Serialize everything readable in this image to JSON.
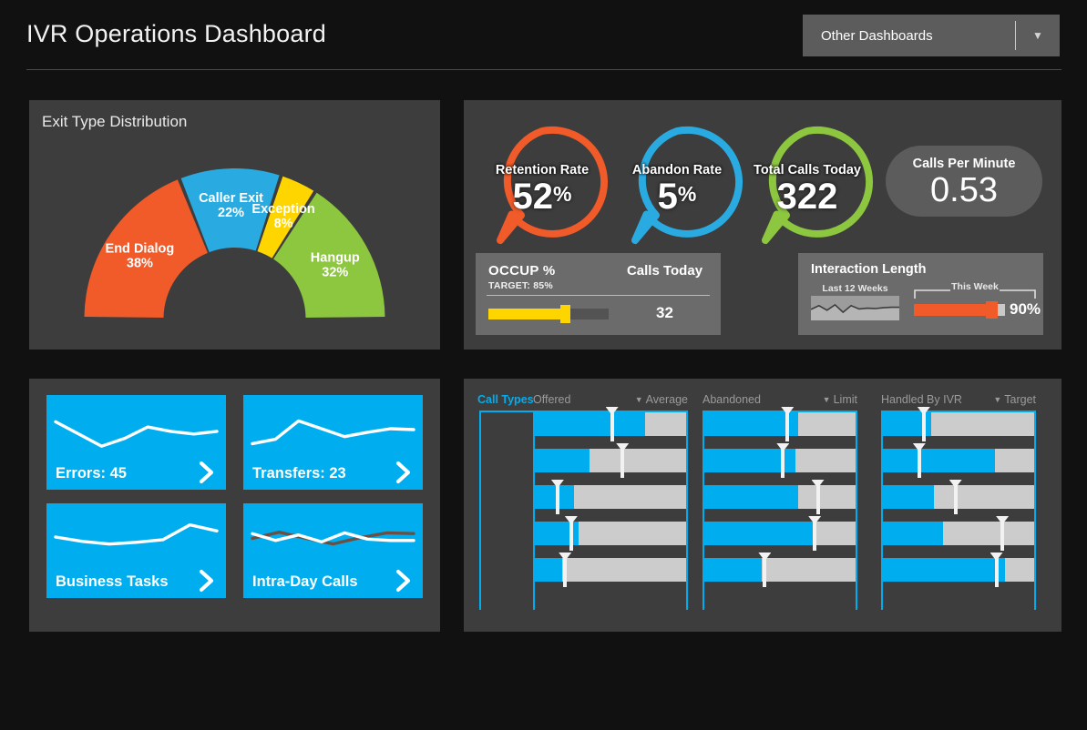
{
  "header": {
    "title": "IVR Operations Dashboard",
    "dropdown_label": "Other Dashboards",
    "dropdown_arrow": "chevron-down-icon"
  },
  "exit_panel": {
    "title": "Exit Type Distribution"
  },
  "chart_data": [
    {
      "type": "pie",
      "title": "Exit Type Distribution",
      "variant": "half-donut",
      "labels": [
        "End Dialog",
        "Caller Exit",
        "Exception",
        "Hangup"
      ],
      "values": [
        38,
        22,
        8,
        32
      ],
      "value_labels": [
        "38%",
        "22%",
        "8%",
        "32%"
      ],
      "colors": [
        "#f15a29",
        "#29abe2",
        "#ffd500",
        "#8dc63f"
      ],
      "units": "percent",
      "legend": "inline-slice-labels"
    },
    {
      "type": "bar",
      "title": "Call Types",
      "variant": "bullet-matrix",
      "row_count": 5,
      "columns": [
        {
          "name": "Offered",
          "comparison": "Average",
          "values": [
            73,
            36,
            26,
            29,
            18
          ],
          "markers": [
            51,
            58,
            15,
            24,
            20
          ]
        },
        {
          "name": "Abandoned",
          "comparison": "Limit",
          "values": [
            62,
            60,
            62,
            74,
            38
          ],
          "markers": [
            55,
            52,
            75,
            73,
            40
          ]
        },
        {
          "name": "Handled By IVR",
          "comparison": "Target",
          "values": [
            32,
            74,
            34,
            40,
            81
          ],
          "markers": [
            27,
            24,
            48,
            79,
            75
          ]
        }
      ],
      "xlim": [
        0,
        100
      ],
      "bar_color": "#00aeef",
      "track_color": "#cccccc",
      "marker_color": "#f2f2f2"
    },
    {
      "type": "line",
      "title": "Errors",
      "variant": "sparkline",
      "values": [
        68,
        40,
        12,
        30,
        56,
        46,
        40,
        46
      ]
    },
    {
      "type": "line",
      "title": "Transfers",
      "variant": "sparkline",
      "values": [
        18,
        28,
        70,
        52,
        34,
        44,
        52,
        50
      ]
    },
    {
      "type": "line",
      "title": "Business Tasks",
      "variant": "sparkline",
      "values": [
        52,
        42,
        36,
        40,
        46,
        80,
        66
      ]
    },
    {
      "type": "line",
      "title": "Intra-Day Calls",
      "variant": "sparkline",
      "series": [
        {
          "name": "white",
          "values": [
            60,
            40,
            56,
            36,
            62,
            44,
            40,
            40
          ]
        },
        {
          "name": "brown",
          "values": [
            46,
            64,
            46,
            30,
            48,
            62,
            60
          ]
        }
      ]
    },
    {
      "type": "area",
      "title": "Last 12 Weeks",
      "variant": "sparkline",
      "values": [
        44,
        62,
        40,
        66,
        30,
        62,
        46,
        50,
        48,
        52,
        54,
        54
      ]
    }
  ],
  "kpis": [
    {
      "label": "Retention Rate",
      "value": "52",
      "unit": "%",
      "color": "#f15a29",
      "shape": "speech-bubble"
    },
    {
      "label": "Abandon Rate",
      "value": "5",
      "unit": "%",
      "color": "#29abe2",
      "shape": "speech-bubble"
    },
    {
      "label": "Total Calls Today",
      "value": "322",
      "unit": "",
      "color": "#8dc63f",
      "shape": "speech-bubble"
    },
    {
      "label": "Calls Per Minute",
      "value": "0.53",
      "unit": "",
      "color": "#5c5c5c",
      "shape": "pill"
    }
  ],
  "occupancy": {
    "title": "OCCUP %",
    "target": "TARGET: 85%",
    "calls_header": "Calls Today",
    "calls_value": "32",
    "bar_percent": 62,
    "marker_percent": 62,
    "bar_color": "#ffd500"
  },
  "interaction_length": {
    "title": "Interaction Length",
    "sparkline_label": "Last 12 Weeks",
    "bar_label": "This Week",
    "percent_text": "90%",
    "bar_percent": 85,
    "bar_color": "#f15a29"
  },
  "mini_cards": [
    {
      "label": "Errors: 45",
      "chevron": "chevron-right-icon"
    },
    {
      "label": "Transfers: 23",
      "chevron": "chevron-right-icon"
    },
    {
      "label": "Business Tasks",
      "chevron": "chevron-right-icon"
    },
    {
      "label": "Intra-Day Calls",
      "chevron": "chevron-right-icon"
    }
  ],
  "call_types": {
    "sidebar_label": "Call Types",
    "columns": [
      {
        "name": "Offered",
        "comparison": "Average"
      },
      {
        "name": "Abandoned",
        "comparison": "Limit"
      },
      {
        "name": "Handled By IVR",
        "comparison": "Target"
      }
    ]
  }
}
